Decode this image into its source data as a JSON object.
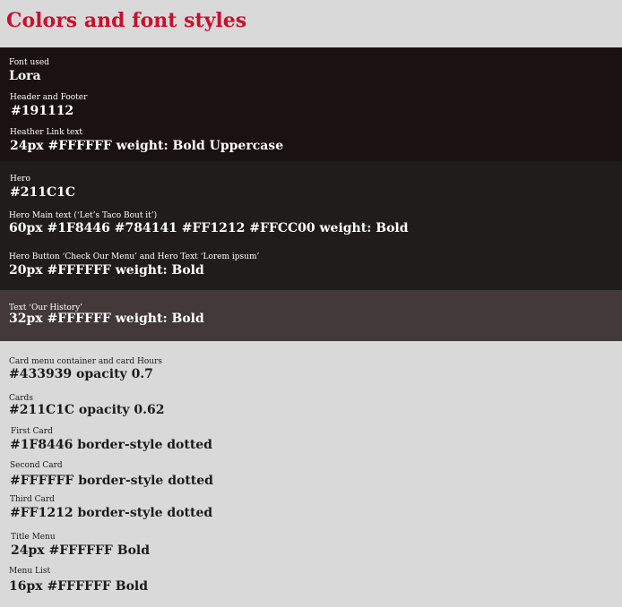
{
  "page": {
    "title": "Colors and font styles",
    "title_color": "#C8102E",
    "background": "#D9D9D9"
  },
  "sections": [
    {
      "id": "header-footer",
      "background": "#191112",
      "entries": [
        {
          "label": "Font used",
          "value": "Lora"
        },
        {
          "label": "Header  and Footer",
          "value": "#191112"
        },
        {
          "label": "Heather Link text",
          "value": "24px #FFFFFF weight: Bold Uppercase"
        }
      ]
    },
    {
      "id": "hero",
      "background": "#211C1C",
      "entries": [
        {
          "label": "Hero",
          "value": "#211C1C"
        },
        {
          "label": "Hero Main text (‘Let’s Taco Bout it’)",
          "value": "60px #1F8446 #784141 #FF1212 #FFCC00 weight: Bold"
        },
        {
          "label": "Hero Button ‘Check Our Menu’ and Hero Text ‘Lorem ipsum’",
          "value": "20px #FFFFFF weight: Bold"
        }
      ]
    },
    {
      "id": "history",
      "background": "#433939",
      "entries": [
        {
          "label": "Text ‘Our History’",
          "value": "32px #FFFFFF weight: Bold"
        }
      ]
    },
    {
      "id": "cards",
      "background": "#D9D9D9",
      "entries": [
        {
          "label": "Card menu container and card Hours",
          "value": "#433939 opacity 0.7"
        },
        {
          "label": "Cards",
          "value": "#211C1C opacity 0.62"
        },
        {
          "label": "First Card",
          "value": "#1F8446 border-style dotted"
        },
        {
          "label": "Second Card",
          "value": "#FFFFFF border-style dotted"
        },
        {
          "label": "Third Card",
          "value": "#FF1212 border-style dotted"
        },
        {
          "label": "Title Menu",
          "value": "24px #FFFFFF Bold"
        },
        {
          "label": "Menu List",
          "value": "16px #FFFFFF Bold"
        }
      ]
    }
  ]
}
